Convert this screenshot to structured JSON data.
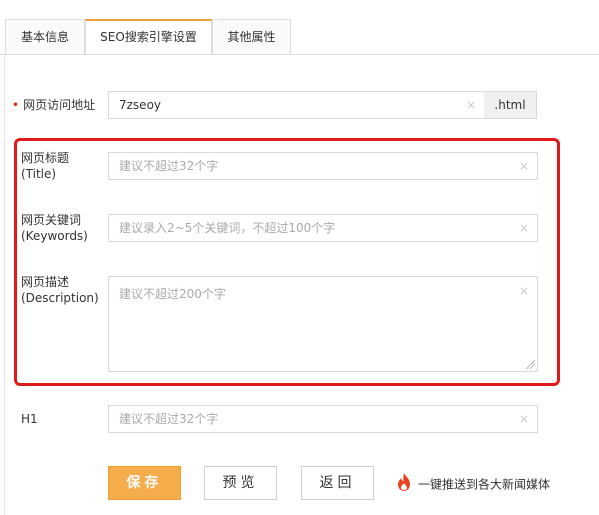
{
  "tabs": [
    {
      "label": "基本信息",
      "active": false
    },
    {
      "label": "SEO搜索引擎设置",
      "active": true
    },
    {
      "label": "其他属性",
      "active": false
    }
  ],
  "form": {
    "url_field": {
      "label": "网页访问地址",
      "required_mark": "•",
      "value": "7zseoy",
      "suffix": ".html"
    },
    "title_field": {
      "label_line1": "网页标题",
      "label_line2": "(Title)",
      "placeholder": "建议不超过32个字"
    },
    "keywords_field": {
      "label_line1": "网页关键词",
      "label_line2": "(Keywords)",
      "placeholder": "建议录入2~5个关键词，不超过100个字"
    },
    "description_field": {
      "label_line1": "网页描述",
      "label_line2": "(Description)",
      "placeholder": "建议不超过200个字"
    },
    "h1_field": {
      "label": "H1",
      "placeholder": "建议不超过32个字"
    },
    "clear_glyph": "×"
  },
  "actions": {
    "save_label": "保存",
    "preview_label": "预览",
    "back_label": "返回",
    "push_label": "一键推送到各大新闻媒体",
    "push_icon": "fire-icon"
  },
  "colors": {
    "accent": "#f5ad4b",
    "highlight_border": "#e01a1a",
    "required_mark": "#e2231a",
    "fire": "#e8421e"
  }
}
